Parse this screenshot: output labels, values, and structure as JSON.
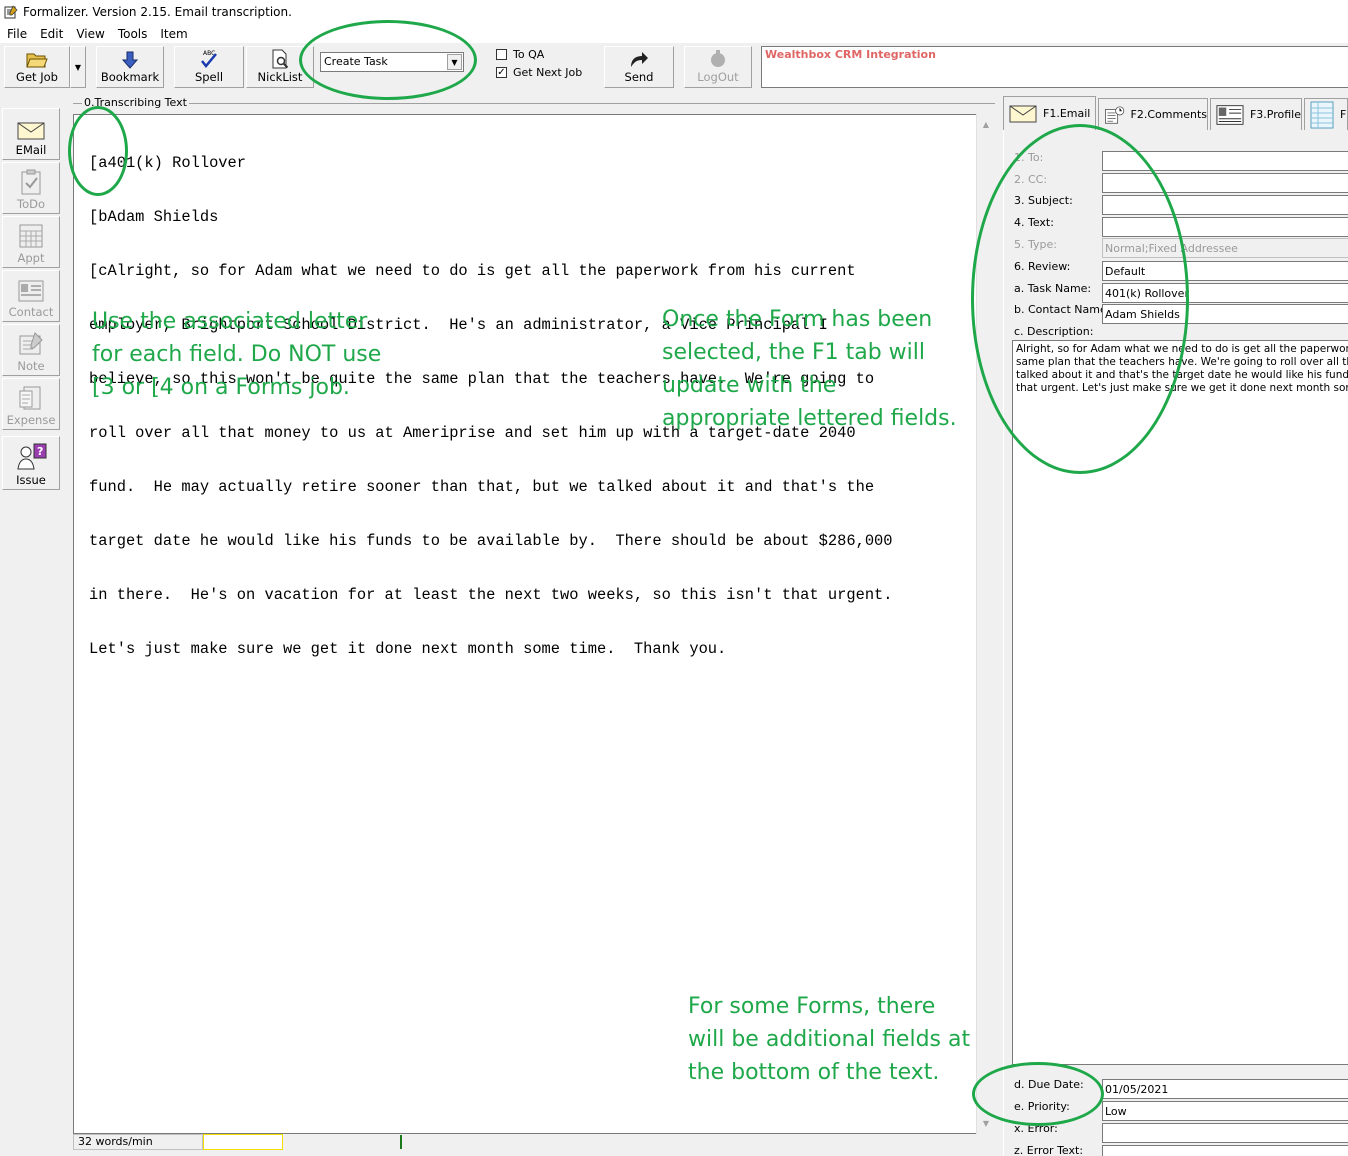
{
  "window": {
    "title": "Formalizer. Version 2.15. Email transcription."
  },
  "menu": [
    "File",
    "Edit",
    "View",
    "Tools",
    "Item"
  ],
  "toolbar": {
    "get_job": "Get Job",
    "bookmark": "Bookmark",
    "spell": "Spell",
    "nicklist": "NickList",
    "form_select": "Create Task",
    "to_qa": "To QA",
    "get_next_job": "Get Next Job",
    "send": "Send",
    "logout": "LogOut",
    "crm_label": "Wealthbox CRM Integration"
  },
  "sidebar": {
    "email": "EMail",
    "todo": "ToDo",
    "appt": "Appt",
    "contact": "Contact",
    "note": "Note",
    "expense": "Expense",
    "issue": "Issue"
  },
  "editor": {
    "group_label": "0.Transcribing Text",
    "lines": [
      "[a401(k) Rollover",
      "[bAdam Shields",
      "[cAlright, so for Adam what we need to do is get all the paperwork from his current",
      "employer, Brightport School District.  He's an administrator, a Vice Principal I",
      "believe, so this won't be quite the same plan that the teachers have.  We're going to",
      "roll over all that money to us at Ameriprise and set him up with a target-date 2040",
      "fund.  He may actually retire sooner than that, but we talked about it and that's the",
      "target date he would like his funds to be available by.  There should be about $286,000",
      "in there.  He's on vacation for at least the next two weeks, so this isn't that urgent.",
      "Let's just make sure we get it done next month some time.  Thank you."
    ]
  },
  "status": {
    "wpm": "32 words/min"
  },
  "annotations": {
    "left": [
      "Use the associated letter",
      "for each field. Do NOT use",
      "[3 or [4 on a Forms job."
    ],
    "right": [
      "Once the Form has been",
      "selected, the F1 tab will",
      "update with the",
      "appropriate lettered fields."
    ],
    "bottom": [
      "For some Forms, there",
      "will be additional fields at",
      "the bottom of the text."
    ]
  },
  "tabs": {
    "f1": "F1.Email",
    "f2": "F2.Comments",
    "f3": "F3.Profile",
    "f4": "F"
  },
  "form": {
    "to_label": "1. To:",
    "cc_label": "2. CC:",
    "subject_label": "3. Subject:",
    "text_label": "4. Text:",
    "type_label": "5. Type:",
    "type_value": "Normal;Fixed Addressee",
    "review_label": "6. Review:",
    "review_value": "Default",
    "task_name_label": "a. Task Name:",
    "task_name_value": "401(k) Rollover",
    "contact_name_label": "b. Contact Name:",
    "contact_name_value": "Adam Shields",
    "description_label": "c. Description:",
    "description_lines": [
      "Alright, so for Adam what we need to do is get all the paperwork from hi",
      "same plan that the teachers have. We're going to roll over all that mon",
      "talked about it and that's the target date he would like his funds to be a",
      "that urgent.  Let's just make sure we get it done next month some time."
    ],
    "due_date_label": "d. Due Date:",
    "due_date_value": "01/05/2021",
    "priority_label": "e. Priority:",
    "priority_value": "Low",
    "error_label": "x. Error:",
    "error_text_label": "z. Error Text:"
  },
  "colors": {
    "annotation": "#1fa84a",
    "crm_text": "#e06666"
  }
}
